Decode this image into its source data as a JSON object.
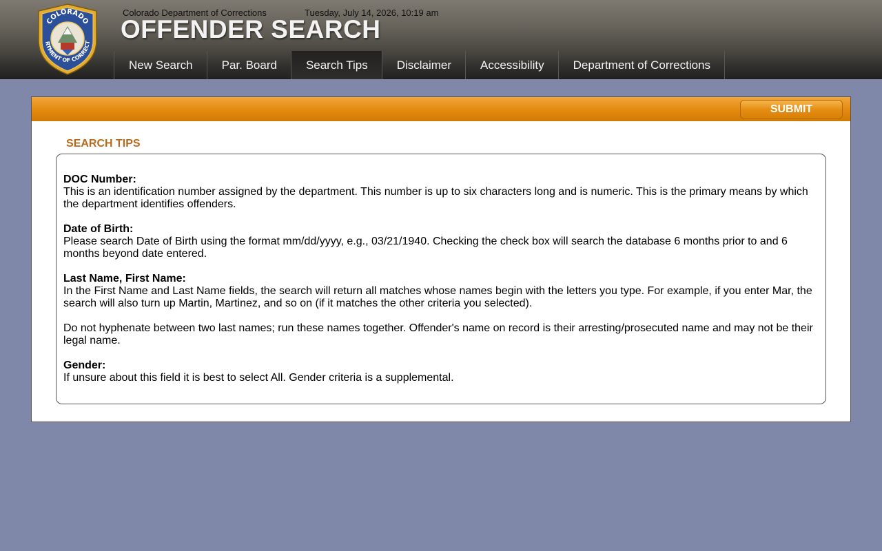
{
  "header": {
    "org_name": "Colorado Department of Corrections",
    "datetime": "Tuesday, July 14, 2026, 10:19 am",
    "app_title": "OFFENDER SEARCH",
    "logo": {
      "top_text": "COLORADO",
      "bottom_text": "DEPARTMENT OF CORRECTIONS"
    }
  },
  "nav": {
    "items": [
      {
        "label": "New Search"
      },
      {
        "label": "Par. Board"
      },
      {
        "label": "Search Tips"
      },
      {
        "label": "Disclaimer"
      },
      {
        "label": "Accessibility"
      },
      {
        "label": "Department of Corrections"
      }
    ],
    "active_index": 2
  },
  "panel": {
    "submit_label": "SUBMIT",
    "section_title": "SEARCH TIPS",
    "tips": [
      {
        "title": "DOC Number:",
        "body": "This is an identification number assigned by the department. This number is up to six characters long and is numeric. This is the primary means by which the department identifies offenders."
      },
      {
        "title": "Date of Birth:",
        "body": "Please search Date of Birth using the format mm/dd/yyyy, e.g., 03/21/1940. Checking the check box will search the database 6 months prior to and 6 months beyond date entered."
      },
      {
        "title": "Last Name, First Name:",
        "body": "In the First Name and Last Name fields, the search will return all matches whose names begin with the letters you type. For example, if you enter Mar, the search will also turn up Martin, Martinez, and so on (if it matches the other criteria you selected)."
      },
      {
        "title": "",
        "body": "Do not hyphenate between two last names; run these names together. Offender's name on record is their arresting/prosecuted name and may not be their legal name."
      },
      {
        "title": "Gender:",
        "body": "If unsure about this field it is best to select All. Gender criteria is a supplemental."
      }
    ]
  },
  "colors": {
    "page_background": "#7f88a9",
    "accent_orange": "#e3890e",
    "section_title": "#b8691a",
    "header_gray": "#66625a",
    "nav_dark": "#302e2b"
  }
}
